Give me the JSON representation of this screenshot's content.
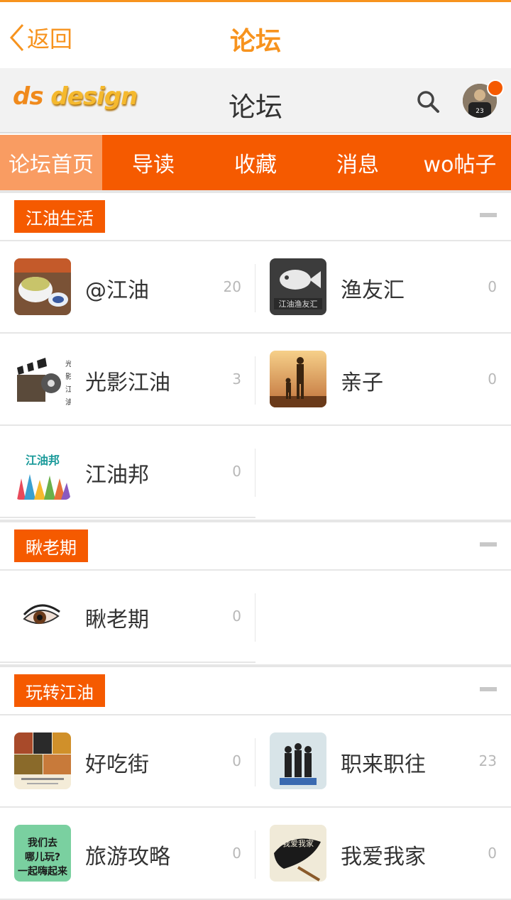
{
  "topbar": {
    "back_label": "返回",
    "title": "论坛"
  },
  "header": {
    "logo_prefix": "ds",
    "logo_suffix": "design",
    "title": "论坛"
  },
  "nav": [
    {
      "label": "论坛首页",
      "active": true
    },
    {
      "label": "导读"
    },
    {
      "label": "收藏"
    },
    {
      "label": "消息"
    },
    {
      "label": "wo帖子"
    }
  ],
  "sections": [
    {
      "title": "江油生活",
      "forums": [
        {
          "name": "@江油",
          "count": "20",
          "icon": "tea-cup-image"
        },
        {
          "name": "渔友汇",
          "count": "0",
          "icon": "fish-logo-image"
        },
        {
          "name": "光影江油",
          "count": "3",
          "icon": "film-clapper-image"
        },
        {
          "name": "亲子",
          "count": "0",
          "icon": "parent-child-sunset-image"
        },
        {
          "name": "江油邦",
          "count": "0",
          "icon": "hands-logo-image"
        }
      ]
    },
    {
      "title": "瞅老期",
      "forums": [
        {
          "name": "瞅老期",
          "count": "0",
          "icon": "eye-image"
        }
      ]
    },
    {
      "title": "玩转江油",
      "forums": [
        {
          "name": "好吃街",
          "count": "0",
          "icon": "food-collage-image"
        },
        {
          "name": "职来职往",
          "count": "23",
          "icon": "business-people-image"
        },
        {
          "name": "旅游攻略",
          "count": "0",
          "icon": "travel-sign-image"
        },
        {
          "name": "我爱我家",
          "count": "0",
          "icon": "calligraphy-image"
        }
      ]
    }
  ]
}
